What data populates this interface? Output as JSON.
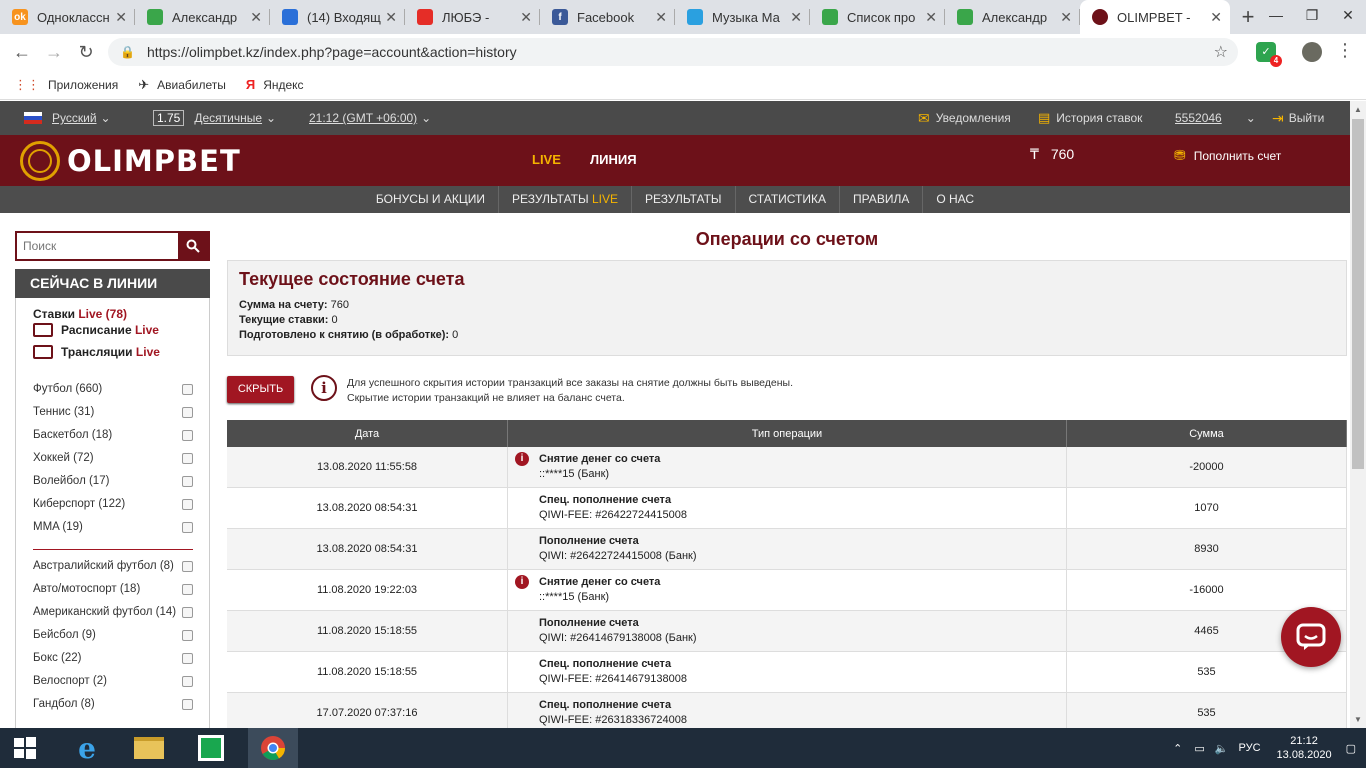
{
  "browser": {
    "tabs": [
      {
        "title": "Одноклассн",
        "fav": "ok",
        "color": "#f7931e"
      },
      {
        "title": "Александр",
        "fav": "",
        "color": "#3aa64a"
      },
      {
        "title": "(14) Входящ",
        "fav": "",
        "color": "#2a6fd8"
      },
      {
        "title": "ЛЮБЭ -",
        "fav": "",
        "color": "#e52d27"
      },
      {
        "title": "Facebook",
        "fav": "f",
        "color": "#3b5998"
      },
      {
        "title": "Музыка Ма",
        "fav": "",
        "color": "#2aa0e0"
      },
      {
        "title": "Список про",
        "fav": "",
        "color": "#3aa64a"
      },
      {
        "title": "Александр",
        "fav": "",
        "color": "#3aa64a"
      },
      {
        "title": "OLIMPBET -",
        "fav": "",
        "color": "#6d1119",
        "active": true
      }
    ],
    "url": "https://olimpbet.kz/index.php?page=account&action=history",
    "extension_badge": "4",
    "bookmarks": [
      {
        "label": "Приложения",
        "icon": "apps-icon"
      },
      {
        "label": "Авиабилеты",
        "icon": "plane-icon"
      },
      {
        "label": "Яндекс",
        "icon": "yandex-icon"
      }
    ]
  },
  "topbar": {
    "language": "Русский",
    "odds_value": "1.75",
    "odds_format": "Десятичные",
    "time": "21:12 (GMT +06:00)",
    "notifications": "Уведомления",
    "bet_history": "История ставок",
    "account_id": "5552046",
    "logout": "Выйти"
  },
  "brand": {
    "logo_text": "OLIMPBET",
    "nav_live": "LIVE",
    "nav_line": "ЛИНИЯ",
    "currency": "₸",
    "balance": "760",
    "deposit": "Пополнить счет"
  },
  "submenu": [
    {
      "label": "БОНУСЫ И АКЦИИ",
      "suffix": ""
    },
    {
      "label": "РЕЗУЛЬТАТЫ",
      "suffix": "LIVE"
    },
    {
      "label": "РЕЗУЛЬТАТЫ",
      "suffix": ""
    },
    {
      "label": "СТАТИСТИКА",
      "suffix": ""
    },
    {
      "label": "ПРАВИЛА",
      "suffix": ""
    },
    {
      "label": "О НАС",
      "suffix": ""
    }
  ],
  "sidebar": {
    "search_placeholder": "Поиск",
    "now_title": "СЕЙЧАС В ЛИНИИ",
    "links": [
      {
        "label": "Ставки",
        "red": "Live (78)"
      },
      {
        "label": "Расписание",
        "red": "Live"
      },
      {
        "label": "Трансляции",
        "red": "Live"
      }
    ],
    "sports_top": [
      "Футбол (660)",
      "Теннис (31)",
      "Баскетбол (18)",
      "Хоккей (72)",
      "Волейбол (17)",
      "Киберспорт (122)",
      "MMA (19)"
    ],
    "sports_more": [
      "Австралийский футбол (8)",
      "Авто/мотоспорт (18)",
      "Американский футбол (14)",
      "Бейсбол (9)",
      "Бокс (22)",
      "Велоспорт (2)",
      "Гандбол (8)"
    ]
  },
  "main": {
    "title": "Операции со счетом",
    "state_title": "Текущее состояние счета",
    "state_rows": [
      {
        "label": "Сумма на счету:",
        "value": "760"
      },
      {
        "label": "Текущие ставки:",
        "value": "0"
      },
      {
        "label": "Подготовлено к снятию (в обработке):",
        "value": "0"
      }
    ],
    "hide_button": "СКРЫТЬ",
    "info_line1": "Для успешного скрытия истории транзакций все заказы на снятие должны быть выведены.",
    "info_line2": "Скрытие истории транзакций не влияет на баланс счета.",
    "columns": [
      "Дата",
      "Тип операции",
      "Сумма"
    ],
    "rows": [
      {
        "date": "13.08.2020 11:55:58",
        "type": "Снятие денег со счета",
        "detail": "::****15 (Банк)",
        "amount": "-20000",
        "warn": true
      },
      {
        "date": "13.08.2020 08:54:31",
        "type": "Спец. пополнение счета",
        "detail": "QIWI-FEE: #26422724415008",
        "amount": "1070",
        "warn": false
      },
      {
        "date": "13.08.2020 08:54:31",
        "type": "Пополнение счета",
        "detail": "QIWI: #26422724415008 (Банк)",
        "amount": "8930",
        "warn": false
      },
      {
        "date": "11.08.2020 19:22:03",
        "type": "Снятие денег со счета",
        "detail": "::****15 (Банк)",
        "amount": "-16000",
        "warn": true
      },
      {
        "date": "11.08.2020 15:18:55",
        "type": "Пополнение счета",
        "detail": "QIWI: #26414679138008 (Банк)",
        "amount": "4465",
        "warn": false
      },
      {
        "date": "11.08.2020 15:18:55",
        "type": "Спец. пополнение счета",
        "detail": "QIWI-FEE: #26414679138008",
        "amount": "535",
        "warn": false
      },
      {
        "date": "17.07.2020 07:37:16",
        "type": "Спец. пополнение счета",
        "detail": "QIWI-FEE: #26318336724008",
        "amount": "535",
        "warn": false
      }
    ]
  },
  "taskbar": {
    "lang": "РУС",
    "time": "21:12",
    "date": "13.08.2020"
  }
}
